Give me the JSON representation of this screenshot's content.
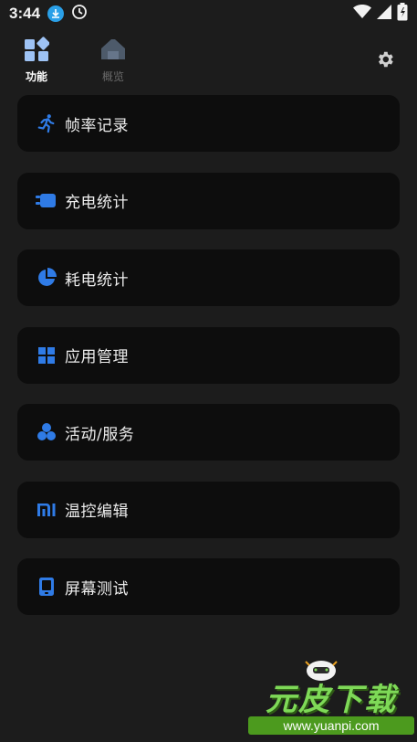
{
  "statusbar": {
    "time": "3:44",
    "icons": [
      "download-icon",
      "clock-icon",
      "wifi-icon",
      "signal-icon",
      "battery-icon"
    ]
  },
  "nav": {
    "tabs": [
      {
        "label": "功能",
        "icon": "grid-icon",
        "active": true
      },
      {
        "label": "概览",
        "icon": "home-icon",
        "active": false
      }
    ],
    "settings_icon": "gear-icon"
  },
  "menu": {
    "items": [
      {
        "label": "帧率记录",
        "icon": "running-icon"
      },
      {
        "label": "充电统计",
        "icon": "charger-icon"
      },
      {
        "label": "耗电统计",
        "icon": "pie-chart-icon"
      },
      {
        "label": "应用管理",
        "icon": "apps-grid-icon"
      },
      {
        "label": "活动/服务",
        "icon": "cluster-icon"
      },
      {
        "label": "温控编辑",
        "icon": "mi-logo-icon"
      },
      {
        "label": "屏幕测试",
        "icon": "phone-screen-icon"
      }
    ]
  },
  "watermark": {
    "title": "元皮下载",
    "url": "www.yuanpi.com"
  },
  "colors": {
    "background": "#1c1c1c",
    "card": "#0d0d0d",
    "accent": "#2f7be6",
    "text": "#ededed"
  }
}
